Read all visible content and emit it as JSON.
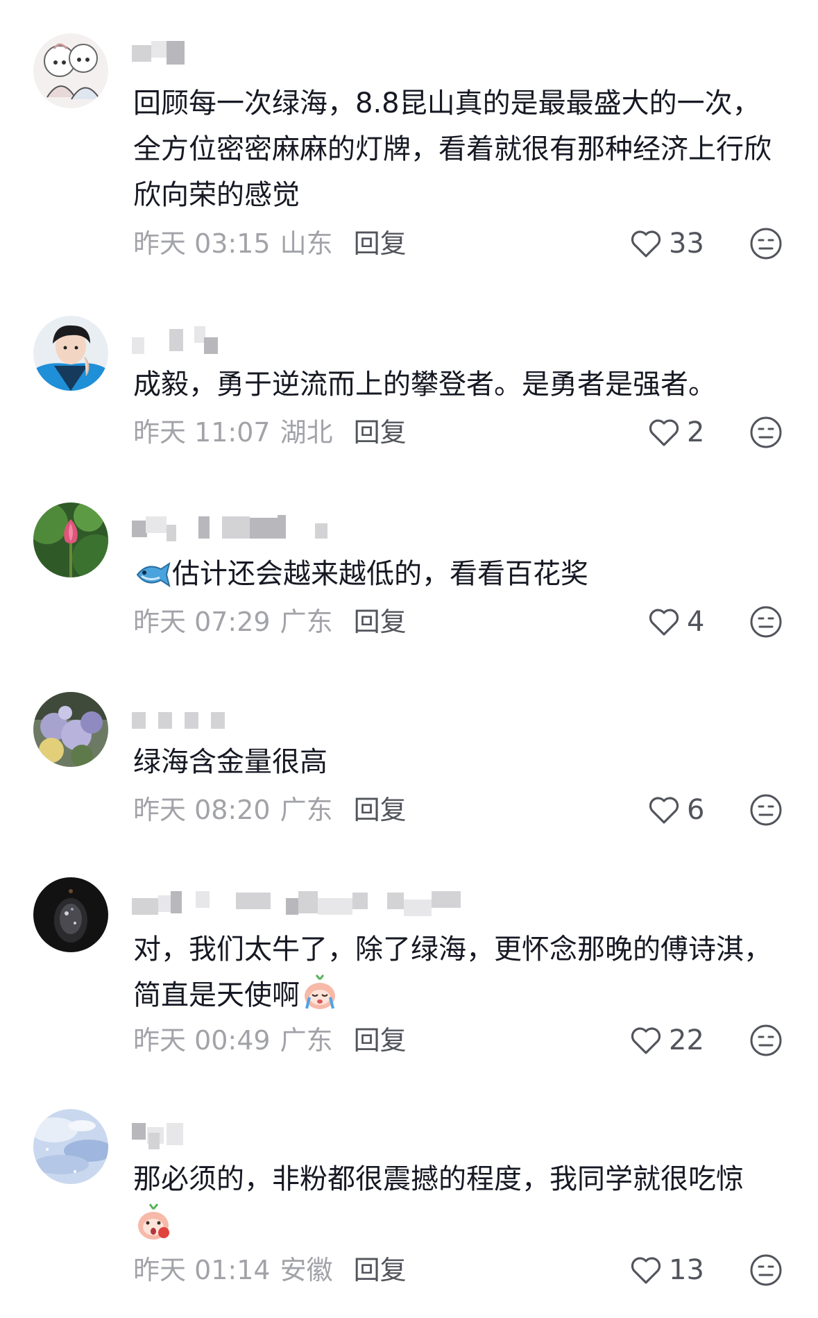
{
  "comments": [
    {
      "text": "回顾每一次绿海，8.8昆山真的是最最盛大的一次，全方位密密麻麻的灯牌，看着就很有那种经济上行欣欣向荣的感觉",
      "time": "昨天 03:15",
      "location": "山东",
      "reply_label": "回复",
      "likes": "33"
    },
    {
      "text": "成毅，勇于逆流而上的攀登者。是勇者是强者。",
      "time": "昨天 11:07",
      "location": "湖北",
      "reply_label": "回复",
      "likes": "2"
    },
    {
      "text": "估计还会越来越低的，看看百花奖",
      "leading_emoji": "fish-emoji",
      "time": "昨天 07:29",
      "location": "广东",
      "reply_label": "回复",
      "likes": "4"
    },
    {
      "text": "绿海含金量很高",
      "time": "昨天 08:20",
      "location": "广东",
      "reply_label": "回复",
      "likes": "6"
    },
    {
      "text": "对，我们太牛了，除了绿海，更怀念那晚的傅诗淇，简直是天使啊",
      "trailing_emoji": "crying-peach-emoji",
      "time": "昨天 00:49",
      "location": "广东",
      "reply_label": "回复",
      "likes": "22"
    },
    {
      "text": "那必须的，非粉都很震撼的程度，我同学就很吃惊",
      "trailing_emoji": "surprised-peach-emoji",
      "time": "昨天 01:14",
      "location": "安徽",
      "reply_label": "回复",
      "likes": "13"
    }
  ],
  "icons": {
    "like": "heart-outline-icon",
    "dislike": "meh-face-icon"
  },
  "colors": {
    "text": "#161823",
    "meta": "#a2a3a8",
    "action": "#52545c"
  }
}
